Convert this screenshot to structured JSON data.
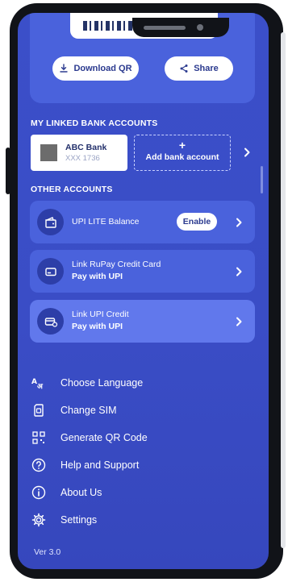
{
  "qr_section": {
    "download_label": "Download QR",
    "share_label": "Share"
  },
  "linked_accounts": {
    "heading": "MY LINKED BANK ACCOUNTS",
    "bank": {
      "name": "ABC Bank",
      "account": "XXX 1736"
    },
    "add_plus": "+",
    "add_label": "Add bank account"
  },
  "other_accounts": {
    "heading": "OTHER ACCOUNTS",
    "items": [
      {
        "title": "UPI LITE Balance",
        "subtitle": "",
        "action": "Enable"
      },
      {
        "title": "Link RuPay Credit Card",
        "subtitle": "Pay with UPI"
      },
      {
        "title": "Link UPI Credit",
        "subtitle": "Pay with UPI"
      }
    ]
  },
  "menu": [
    {
      "label": "Choose Language",
      "icon": "language-icon"
    },
    {
      "label": "Change SIM",
      "icon": "sim-icon"
    },
    {
      "label": "Generate QR Code",
      "icon": "qr-code-icon"
    },
    {
      "label": "Help and Support",
      "icon": "help-icon"
    },
    {
      "label": "About Us",
      "icon": "info-icon"
    },
    {
      "label": "Settings",
      "icon": "gear-icon"
    }
  ],
  "version": "Ver 3.0",
  "colors": {
    "background": "#3b4fc9",
    "card": "#4a62dc",
    "card_active": "#6178ec",
    "text_dark": "#2b3a8f"
  }
}
